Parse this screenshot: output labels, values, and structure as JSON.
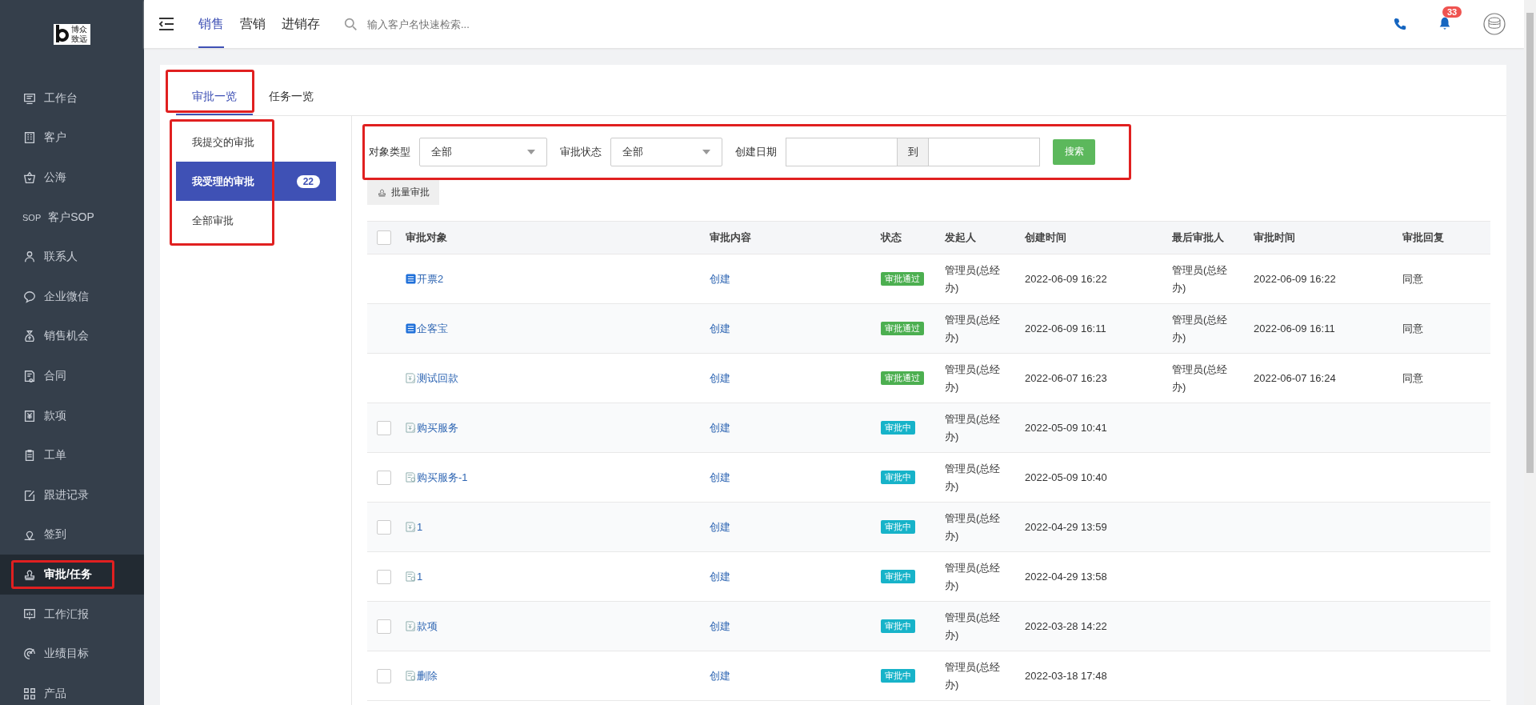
{
  "sidebar": {
    "logo": {
      "line_1": "博众",
      "line_2": "致远"
    },
    "items": [
      {
        "label": "工作台",
        "selected": false,
        "highlighted": false
      },
      {
        "label": "客户",
        "selected": false,
        "highlighted": false
      },
      {
        "label": "公海",
        "selected": false,
        "highlighted": false
      },
      {
        "label": "客户SOP",
        "icon_text": "SOP",
        "selected": false,
        "highlighted": false
      },
      {
        "label": "联系人",
        "selected": false,
        "highlighted": false
      },
      {
        "label": "企业微信",
        "selected": false,
        "highlighted": false
      },
      {
        "label": "销售机会",
        "selected": false,
        "highlighted": false
      },
      {
        "label": "合同",
        "selected": false,
        "highlighted": false
      },
      {
        "label": "款项",
        "selected": false,
        "highlighted": false
      },
      {
        "label": "工单",
        "selected": false,
        "highlighted": false
      },
      {
        "label": "跟进记录",
        "selected": false,
        "highlighted": false
      },
      {
        "label": "签到",
        "selected": false,
        "highlighted": false
      },
      {
        "label": "审批/任务",
        "selected": true,
        "highlighted": true
      },
      {
        "label": "工作汇报",
        "selected": false,
        "highlighted": false
      },
      {
        "label": "业绩目标",
        "selected": false,
        "highlighted": false
      },
      {
        "label": "产品",
        "selected": false,
        "highlighted": false
      }
    ]
  },
  "topbar": {
    "tabs": [
      {
        "label": "销售",
        "selected": true
      },
      {
        "label": "营销",
        "selected": false
      },
      {
        "label": "进销存",
        "selected": false
      }
    ],
    "search": {
      "placeholder": "输入客户名快速检索..."
    },
    "notification_count": "33"
  },
  "tabs": [
    {
      "label": "审批一览",
      "selected": true,
      "highlighted": true
    },
    {
      "label": "任务一览",
      "selected": false,
      "highlighted": false
    }
  ],
  "submenu": {
    "highlighted": true,
    "items": [
      {
        "label": "我提交的审批",
        "selected": false
      },
      {
        "label": "我受理的审批",
        "selected": true,
        "count": "22"
      },
      {
        "label": "全部审批",
        "selected": false
      }
    ]
  },
  "filters": {
    "highlighted": true,
    "object_type": {
      "label": "对象类型",
      "value": "全部"
    },
    "status": {
      "label": "审批状态",
      "value": "全部"
    },
    "created_date": {
      "label": "创建日期",
      "separator": "到"
    },
    "search_button": "搜索"
  },
  "batch_button": "批量审批",
  "table": {
    "all_checked": false,
    "columns": [
      "审批对象",
      "审批内容",
      "状态",
      "发起人",
      "创建时间",
      "最后审批人",
      "审批时间",
      "审批回复"
    ],
    "rows": [
      {
        "kind": "invoice",
        "object": "开票2",
        "content": "创建",
        "status": "审批通过",
        "approved": true,
        "initiator": "管理员(总经办)",
        "created": "2022-06-09 16:22",
        "last_approver": "管理员(总经办)",
        "approved_time": "2022-06-09 16:22",
        "reply": "同意"
      },
      {
        "kind": "invoice",
        "object": "企客宝",
        "content": "创建",
        "status": "审批通过",
        "approved": true,
        "initiator": "管理员(总经办)",
        "created": "2022-06-09 16:11",
        "last_approver": "管理员(总经办)",
        "approved_time": "2022-06-09 16:11",
        "reply": "同意"
      },
      {
        "kind": "payment",
        "object": "测试回款",
        "content": "创建",
        "status": "审批通过",
        "approved": true,
        "initiator": "管理员(总经办)",
        "created": "2022-06-07 16:23",
        "last_approver": "管理员(总经办)",
        "approved_time": "2022-06-07 16:24",
        "reply": "同意"
      },
      {
        "kind": "payment",
        "checked": false,
        "object": "购买服务",
        "content": "创建",
        "status": "审批中",
        "approved": false,
        "initiator": "管理员(总经办)",
        "created": "2022-05-09 10:41"
      },
      {
        "kind": "contract",
        "checked": false,
        "object": "购买服务-1",
        "content": "创建",
        "status": "审批中",
        "approved": false,
        "initiator": "管理员(总经办)",
        "created": "2022-05-09 10:40"
      },
      {
        "kind": "payment",
        "checked": false,
        "object": "1",
        "content": "创建",
        "status": "审批中",
        "approved": false,
        "initiator": "管理员(总经办)",
        "created": "2022-04-29 13:59"
      },
      {
        "kind": "contract",
        "checked": false,
        "object": "1",
        "content": "创建",
        "status": "审批中",
        "approved": false,
        "initiator": "管理员(总经办)",
        "created": "2022-04-29 13:58"
      },
      {
        "kind": "payment",
        "checked": false,
        "object": "款项",
        "content": "创建",
        "status": "审批中",
        "approved": false,
        "initiator": "管理员(总经办)",
        "created": "2022-03-28 14:22"
      },
      {
        "kind": "contract",
        "checked": false,
        "object": "删除",
        "content": "创建",
        "status": "审批中",
        "approved": false,
        "initiator": "管理员(总经办)",
        "created": "2022-03-18 17:48"
      }
    ]
  }
}
